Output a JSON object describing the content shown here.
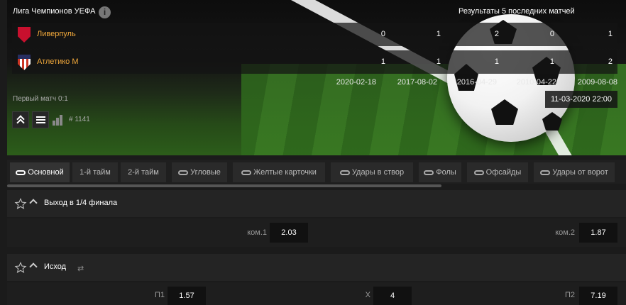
{
  "header": {
    "league": "Лига Чемпионов УЕФА",
    "info_icon": "i",
    "results_title": "Результаты 5 последних матчей",
    "teams": [
      {
        "name": "Ливерпуль",
        "crest": "liverpool-crest-icon",
        "scores": [
          "0",
          "1",
          "2",
          "0",
          "1"
        ]
      },
      {
        "name": "Атлетико М",
        "crest": "atletico-crest-icon",
        "scores": [
          "1",
          "1",
          "1",
          "1",
          "2"
        ]
      }
    ],
    "dates": [
      "2020-02-18",
      "2017-08-02",
      "2016-04-29",
      "2010-04-22",
      "2009-08-08"
    ],
    "first_match": "Первый матч 0:1",
    "datetime": "11-03-2020  22:00",
    "match_id": "# 1141"
  },
  "tabs": [
    {
      "label": "Основной",
      "icon": "link-icon",
      "active": true
    },
    {
      "label": "1-й тайм",
      "icon": "",
      "active": false
    },
    {
      "label": "2-й тайм",
      "icon": "",
      "active": false
    },
    {
      "label": "Угловые",
      "icon": "link-icon",
      "active": false
    },
    {
      "label": "Желтые карточки",
      "icon": "link-icon",
      "active": false
    },
    {
      "label": "Удары в створ",
      "icon": "link-icon",
      "active": false
    },
    {
      "label": "Фолы",
      "icon": "link-icon",
      "active": false
    },
    {
      "label": "Офсайды",
      "icon": "link-icon",
      "active": false
    },
    {
      "label": "Удары от ворот",
      "icon": "link-icon",
      "active": false
    }
  ],
  "markets": [
    {
      "title": "Выход в 1/4 финала",
      "odds": [
        {
          "label": "ком.1",
          "value": "2.03"
        },
        {
          "label": "ком.2",
          "value": "1.87"
        }
      ]
    },
    {
      "title": "Исход",
      "odds": [
        {
          "label": "П1",
          "value": "1.57"
        },
        {
          "label": "X",
          "value": "4"
        },
        {
          "label": "П2",
          "value": "7.19"
        }
      ]
    }
  ],
  "colors": {
    "team_name": "#f2a93b",
    "background": "#1b1b1b",
    "odd_box": "#111111"
  }
}
